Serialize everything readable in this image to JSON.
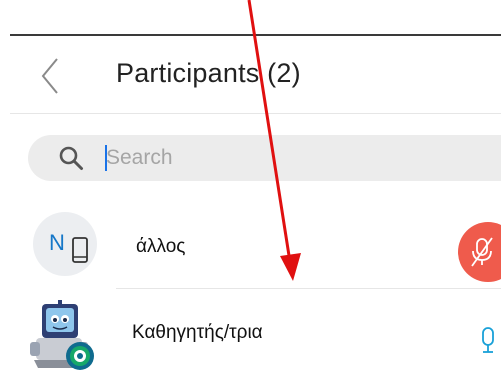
{
  "header": {
    "title": "Participants (2)"
  },
  "search": {
    "placeholder": "Search",
    "value": ""
  },
  "participants": [
    {
      "name": "άλλος",
      "avatar_letter": "N",
      "device": "phone-icon",
      "mic_state": "muted",
      "mic_color": "#ef5b4c"
    },
    {
      "name": "Καθηγητής/τρια",
      "avatar": "robot-avatar",
      "mic_state": "active",
      "mic_color": "#1aa1d8"
    }
  ],
  "annotation": {
    "arrow": "red-arrow",
    "color": "#e01010"
  }
}
